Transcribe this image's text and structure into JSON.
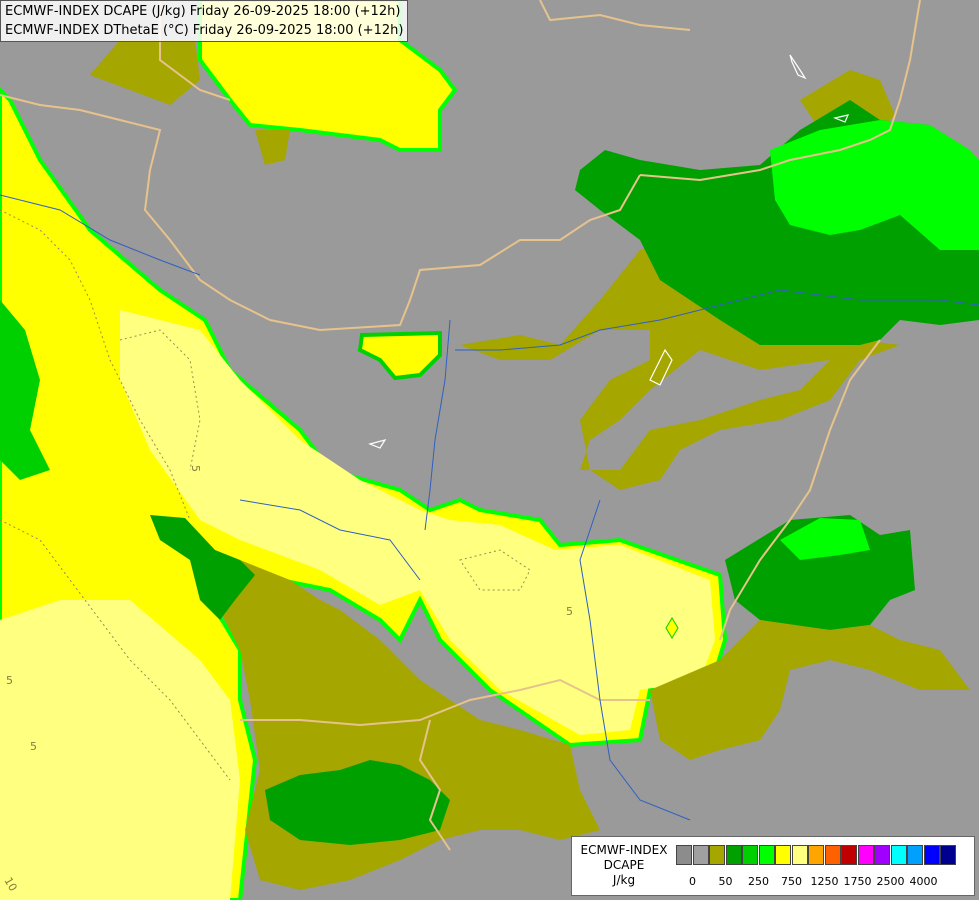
{
  "header": {
    "line1": "ECMWF-INDEX DCAPE (J/kg) Friday 26-09-2025 18:00 (+12h)",
    "line2": "ECMWF-INDEX DThetaE (°C) Friday 26-09-2025 18:00 (+12h)"
  },
  "legend": {
    "model": "ECMWF-INDEX",
    "variable": "DCAPE",
    "unit": "J/kg",
    "colors": [
      "#8c8c8c",
      "#a0a0a0",
      "#a6a600",
      "#00a000",
      "#00d000",
      "#00ff00",
      "#ffff00",
      "#ffff80",
      "#ffa500",
      "#ff6000",
      "#c00000",
      "#ff00ff",
      "#a000ff",
      "#00ffff",
      "#00a0ff",
      "#0000ff",
      "#000090"
    ],
    "tick_labels": [
      "0",
      "50",
      "250",
      "750",
      "1250",
      "1750",
      "2500",
      "4000"
    ]
  },
  "contour_labels": [
    "5",
    "5",
    "5",
    "5",
    "10"
  ],
  "colors": {
    "gray": "#9a9a9a",
    "olive": "#a6a600",
    "dark_green": "#00a000",
    "bright_green": "#00ff00",
    "yellow": "#ffff00",
    "light_yellow": "#ffff80",
    "border": "#e6c38c"
  }
}
